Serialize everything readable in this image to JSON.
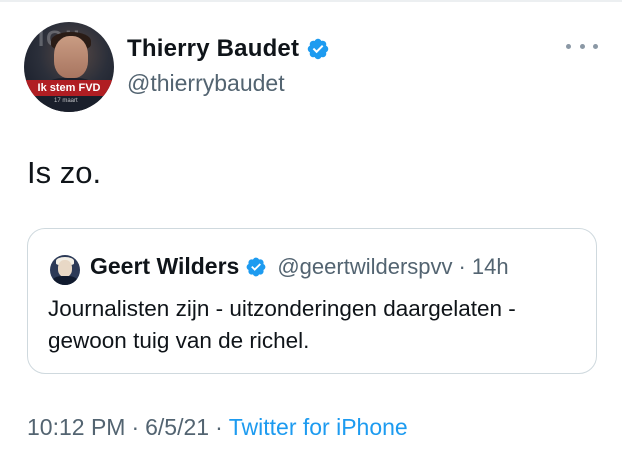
{
  "author": {
    "display_name": "Thierry Baudet",
    "handle": "@thierrybaudet",
    "avatar_banner": "Ik stem FVD",
    "avatar_chip": "17 maart",
    "avatar_bg_text": "IGII",
    "verified_icon": "verified-badge-icon"
  },
  "tweet": {
    "text": "Is zo."
  },
  "quoted": {
    "display_name": "Geert Wilders",
    "handle": "@geertwilderspvv",
    "separator": "·",
    "time": "14h",
    "text": "Journalisten zijn - uitzonderingen daargelaten - gewoon tuig van de richel."
  },
  "meta": {
    "time": "10:12 PM",
    "separator": "·",
    "date": "6/5/21",
    "source": "Twitter for iPhone"
  },
  "icons": {
    "more": "more-options-icon"
  },
  "colors": {
    "verified": "#1d9bf0",
    "link": "#1d9bf0",
    "secondary_text": "#536471",
    "border": "#cfd9de"
  }
}
